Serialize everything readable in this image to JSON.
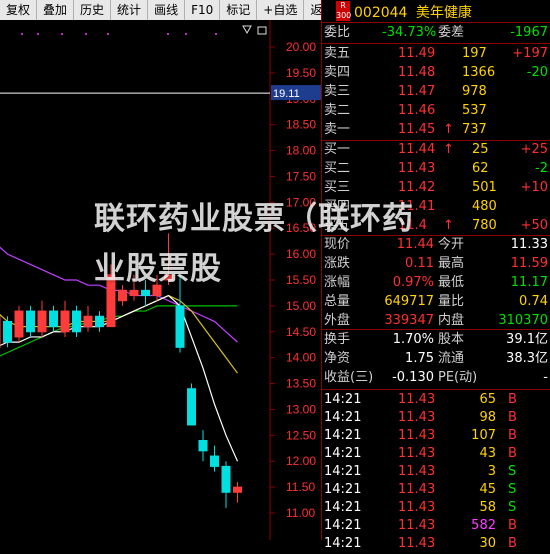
{
  "toolbar": [
    "复权",
    "叠加",
    "历史",
    "统计",
    "画线",
    "F10",
    "标记",
    "+自选",
    "返回"
  ],
  "chart": {
    "price_ticks": [
      "20.00",
      "19.50",
      "19.00",
      "18.50",
      "18.00",
      "17.50",
      "17.00",
      "16.50",
      "16.00",
      "15.50",
      "15.00",
      "14.50",
      "14.00",
      "13.50",
      "13.00",
      "12.50",
      "12.00",
      "11.50",
      "11.00"
    ],
    "current_price_label": "19.11",
    "candles": [
      {
        "o": 14.2,
        "c": 14.8,
        "h": 14.9,
        "l": 14.0
      },
      {
        "o": 14.7,
        "c": 14.3,
        "h": 14.8,
        "l": 14.2
      },
      {
        "o": 14.4,
        "c": 14.9,
        "h": 15.0,
        "l": 14.3
      },
      {
        "o": 14.9,
        "c": 14.5,
        "h": 15.0,
        "l": 14.4
      },
      {
        "o": 14.5,
        "c": 14.9,
        "h": 15.1,
        "l": 14.4
      },
      {
        "o": 14.9,
        "c": 14.6,
        "h": 15.0,
        "l": 14.5
      },
      {
        "o": 14.5,
        "c": 14.9,
        "h": 15.1,
        "l": 14.4
      },
      {
        "o": 14.9,
        "c": 14.5,
        "h": 15.0,
        "l": 14.4
      },
      {
        "o": 14.6,
        "c": 14.8,
        "h": 15.0,
        "l": 14.5
      },
      {
        "o": 14.8,
        "c": 14.6,
        "h": 14.9,
        "l": 14.5
      },
      {
        "o": 14.6,
        "c": 15.6,
        "h": 15.8,
        "l": 14.6
      },
      {
        "o": 15.1,
        "c": 15.3,
        "h": 15.4,
        "l": 15.0
      },
      {
        "o": 15.2,
        "c": 15.3,
        "h": 15.6,
        "l": 15.1
      },
      {
        "o": 15.3,
        "c": 15.2,
        "h": 15.5,
        "l": 15.0
      },
      {
        "o": 15.2,
        "c": 15.4,
        "h": 15.6,
        "l": 15.1
      },
      {
        "o": 15.5,
        "c": 15.6,
        "h": 16.4,
        "l": 15.4
      },
      {
        "o": 15.0,
        "c": 14.2,
        "h": 15.6,
        "l": 14.1
      },
      {
        "o": 13.4,
        "c": 12.7,
        "h": 13.5,
        "l": 12.7
      },
      {
        "o": 12.4,
        "c": 12.2,
        "h": 12.6,
        "l": 12.0
      },
      {
        "o": 12.1,
        "c": 11.9,
        "h": 12.3,
        "l": 11.8
      },
      {
        "o": 11.9,
        "c": 11.4,
        "h": 12.0,
        "l": 11.1
      },
      {
        "o": 11.4,
        "c": 11.5,
        "h": 11.6,
        "l": 11.2
      }
    ],
    "ma_white": [
      14.2,
      14.3,
      14.3,
      14.4,
      14.4,
      14.5,
      14.5,
      14.6,
      14.6,
      14.6,
      14.7,
      14.8,
      14.9,
      15.0,
      15.1,
      15.2,
      15.0,
      14.4,
      13.8,
      13.1,
      12.5,
      12.0
    ],
    "ma_yellow": [
      14.9,
      14.7,
      14.6,
      14.6,
      14.6,
      14.6,
      14.6,
      14.7,
      14.7,
      14.7,
      14.7,
      14.8,
      14.9,
      15.0,
      15.1,
      15.2,
      15.1,
      14.9,
      14.6,
      14.3,
      14.0,
      13.7
    ],
    "ma_magenta": [
      16.2,
      16.0,
      15.9,
      15.8,
      15.7,
      15.6,
      15.5,
      15.5,
      15.4,
      15.4,
      15.3,
      15.3,
      15.2,
      15.2,
      15.2,
      15.1,
      15.0,
      14.9,
      14.8,
      14.7,
      14.5,
      14.3
    ],
    "ma_green": [
      14.0,
      14.1,
      14.2,
      14.3,
      14.4,
      14.5,
      14.6,
      14.6,
      14.7,
      14.7,
      14.8,
      14.8,
      14.9,
      14.9,
      15.0,
      15.0,
      15.0,
      15.0,
      15.0,
      15.0,
      15.0,
      15.0
    ]
  },
  "quote": {
    "badge_top": "R",
    "badge_bottom": "300",
    "code": "002044",
    "name": "美年健康",
    "weibi_label": "委比",
    "weibi_value": "-34.73%",
    "weicha_label": "委差",
    "weicha_value": "-1967",
    "asks": [
      {
        "label": "卖五",
        "price": "11.49",
        "vol": "197",
        "chg": "+197"
      },
      {
        "label": "卖四",
        "price": "11.48",
        "vol": "1366",
        "chg": "-20"
      },
      {
        "label": "卖三",
        "price": "11.47",
        "vol": "978",
        "chg": ""
      },
      {
        "label": "卖二",
        "price": "11.46",
        "vol": "537",
        "chg": ""
      },
      {
        "label": "卖一",
        "price": "11.45",
        "vol": "737",
        "chg": "",
        "arrow": "↑"
      }
    ],
    "bids": [
      {
        "label": "买一",
        "price": "11.44",
        "vol": "25",
        "chg": "+25",
        "arrow": "↑"
      },
      {
        "label": "买二",
        "price": "11.43",
        "vol": "62",
        "chg": "-2"
      },
      {
        "label": "买三",
        "price": "11.42",
        "vol": "501",
        "chg": "+10"
      },
      {
        "label": "买四",
        "price": "11.41",
        "vol": "480",
        "chg": ""
      },
      {
        "label": "买五",
        "price": "11.4",
        "vol": "780",
        "chg": "+50",
        "arrow": "↑"
      }
    ],
    "stats": [
      {
        "l1": "现价",
        "v1": "11.44",
        "c1": "red",
        "l2": "今开",
        "v2": "11.33",
        "c2": "wht"
      },
      {
        "l1": "涨跌",
        "v1": "0.11",
        "c1": "red",
        "l2": "最高",
        "v2": "11.59",
        "c2": "red"
      },
      {
        "l1": "涨幅",
        "v1": "0.97%",
        "c1": "red",
        "l2": "最低",
        "v2": "11.17",
        "c2": "grn"
      },
      {
        "l1": "总量",
        "v1": "649717",
        "c1": "yel",
        "l2": "量比",
        "v2": "0.74",
        "c2": "yel"
      },
      {
        "l1": "外盘",
        "v1": "339347",
        "c1": "red",
        "l2": "内盘",
        "v2": "310370",
        "c2": "grn"
      }
    ],
    "stats2": [
      {
        "l1": "换手",
        "v1": "1.70%",
        "c1": "wht",
        "l2": "股本",
        "v2": "39.1亿",
        "c2": "wht"
      },
      {
        "l1": "净资",
        "v1": "1.75",
        "c1": "wht",
        "l2": "流通",
        "v2": "38.3亿",
        "c2": "wht"
      },
      {
        "l1": "收益(三)",
        "v1": "-0.130",
        "c1": "wht",
        "l2": "PE(动)",
        "v2": "-",
        "c2": "wht"
      }
    ],
    "ticks": [
      {
        "time": "14:21",
        "price": "11.43",
        "vol": "65",
        "side": "B",
        "vcolor": "yel",
        "scolor": "red"
      },
      {
        "time": "14:21",
        "price": "11.43",
        "vol": "98",
        "side": "B",
        "vcolor": "yel",
        "scolor": "red"
      },
      {
        "time": "14:21",
        "price": "11.43",
        "vol": "107",
        "side": "B",
        "vcolor": "yel",
        "scolor": "red"
      },
      {
        "time": "14:21",
        "price": "11.43",
        "vol": "43",
        "side": "B",
        "vcolor": "yel",
        "scolor": "red"
      },
      {
        "time": "14:21",
        "price": "11.43",
        "vol": "3",
        "side": "S",
        "vcolor": "yel",
        "scolor": "grn"
      },
      {
        "time": "14:21",
        "price": "11.43",
        "vol": "45",
        "side": "S",
        "vcolor": "yel",
        "scolor": "grn"
      },
      {
        "time": "14:21",
        "price": "11.43",
        "vol": "58",
        "side": "S",
        "vcolor": "yel",
        "scolor": "grn"
      },
      {
        "time": "14:21",
        "price": "11.43",
        "vol": "582",
        "side": "B",
        "vcolor": "mag",
        "scolor": "red"
      },
      {
        "time": "14:21",
        "price": "11.43",
        "vol": "30",
        "side": "B",
        "vcolor": "yel",
        "scolor": "red"
      }
    ]
  },
  "watermark": {
    "line1": "联环药业股票（联环药",
    "line2": "业股票股"
  }
}
